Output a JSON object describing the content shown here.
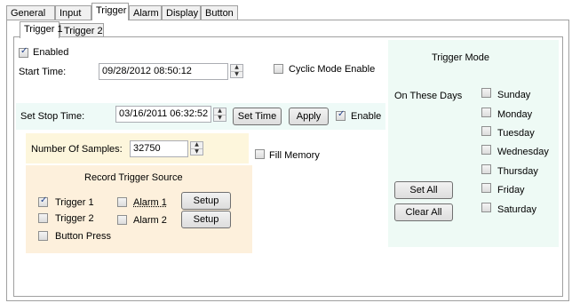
{
  "main_tabs": [
    "General",
    "Input",
    "Trigger",
    "Alarm",
    "Display",
    "Button"
  ],
  "sub_tabs": [
    "Trigger 1",
    "Trigger 2"
  ],
  "enabled": {
    "label": "Enabled",
    "checked": true
  },
  "start_time": {
    "label": "Start Time:",
    "value": "09/28/2012 08:50:12"
  },
  "cyclic_mode": {
    "label": "Cyclic Mode Enable",
    "checked": false
  },
  "stop_time": {
    "label": "Set Stop Time:",
    "value": "03/16/2011 06:32:52",
    "set_button": "Set Time",
    "apply_button": "Apply",
    "enable_label": "Enable",
    "enable_checked": true
  },
  "samples": {
    "label": "Number Of Samples:",
    "value": "32750"
  },
  "fill_memory": {
    "label": "Fill Memory",
    "checked": false
  },
  "record_source": {
    "title": "Record Trigger Source",
    "trigger1": {
      "label": "Trigger 1",
      "checked": true
    },
    "trigger2": {
      "label": "Trigger 2",
      "checked": false
    },
    "button_press": {
      "label": "Button Press",
      "checked": false
    },
    "alarm1": {
      "label": "Alarm 1",
      "checked": false
    },
    "alarm2": {
      "label": "Alarm 2",
      "checked": false
    },
    "setup_label": "Setup"
  },
  "trigger_mode": {
    "title": "Trigger Mode",
    "days_label": "On These Days",
    "set_all": "Set All",
    "clear_all": "Clear All",
    "days": [
      "Sunday",
      "Monday",
      "Tuesday",
      "Wednesday",
      "Thursday",
      "Friday",
      "Saturday"
    ]
  },
  "colors": {
    "stop_time_bg": "#eefaf7",
    "samples_bg": "#fdf6dc",
    "record_bg": "#fdf0dc",
    "trigger_mode_bg": "#eefaf5"
  }
}
